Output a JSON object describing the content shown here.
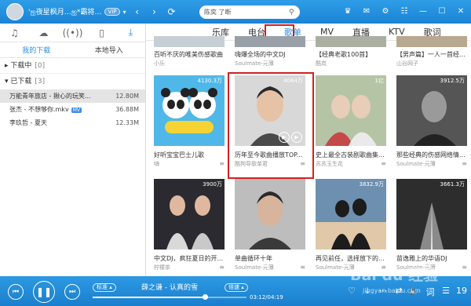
{
  "titlebar": {
    "username": "'ஐ夜星枫月…ஐ*霸将…",
    "vip": "VIP",
    "search_value": "陈奕 了断"
  },
  "left": {
    "tabs": [
      "♫",
      "☁",
      "((•))",
      "▯",
      "⤓"
    ],
    "subtabs": [
      "我的下载",
      "本地导入"
    ],
    "groups": [
      {
        "label": "下载中",
        "count": "[0]"
      },
      {
        "label": "已下载",
        "count": "[3]"
      }
    ],
    "files": [
      {
        "name": "万能青年旅店 - 揪心的玩笑...",
        "size": "12.80M",
        "tag": ""
      },
      {
        "name": "张杰 - 不想够你.mkv",
        "size": "36.88M",
        "tag": "MV"
      },
      {
        "name": "李玖哲 - 夏天",
        "size": "12.33M",
        "tag": ""
      }
    ]
  },
  "nav": {
    "items": [
      "乐库",
      "电台",
      "歌单",
      "MV",
      "直播",
      "KTV",
      "歌词"
    ],
    "active": "歌单"
  },
  "grid": {
    "top_row": [
      {
        "title": "百听不厌的唯美伤感歌曲",
        "sub": "小乐"
      },
      {
        "title": "嗨爆全场的中文DJ",
        "sub": "Soulmate-元薄"
      },
      {
        "title": "【经典老歌100首】",
        "sub": "酷岚"
      },
      {
        "title": "【男声篇】一人一首经...",
        "sub": "山谷网子"
      }
    ],
    "row1": [
      {
        "title": "好听宝宝巴士儿歌",
        "sub": "嗨",
        "plays": "4130.3万",
        "color": "#4fb8e8"
      },
      {
        "title": "历年至今歌曲播放TOP...",
        "sub": "酷狗导歌单君",
        "plays": "4064万",
        "color": "#d8d8d8"
      },
      {
        "title": "史上最全古装剧歌曲集...",
        "sub": "苏苏玉生花",
        "plays": "1亿",
        "color": "#b6c4a6"
      },
      {
        "title": "那些经典的伤感网络情...",
        "sub": "Soulmate-元薄",
        "plays": "3912.5万",
        "color": "#555555"
      }
    ],
    "row2": [
      {
        "title": "中文DJ，疯狂夏日的开...",
        "sub": "柠檬茶",
        "plays": "3900万",
        "color": "#2a2a30"
      },
      {
        "title": "单曲循环十年",
        "sub": "Soulmate-元薄",
        "plays": "",
        "color": "#bdbdbd"
      },
      {
        "title": "再见前任，选择放下的...",
        "sub": "Soulmate-元薄",
        "plays": "3832.9万",
        "color": "#6d8fb0"
      },
      {
        "title": "苗逸雅上的华语DJ",
        "sub": "Soulmate-元薄",
        "plays": "3661.3万",
        "color": "#2d2d2d"
      }
    ]
  },
  "player": {
    "mode_left": "标准 ▴",
    "song": "薛之谦 - 认真的雪",
    "quality": "倍速 ▴",
    "time": "03:12/04:19",
    "progress": 0.73,
    "count": "19"
  },
  "watermark": {
    "brand": "Bai du 经验",
    "url": "jingyan.baidu.com"
  }
}
